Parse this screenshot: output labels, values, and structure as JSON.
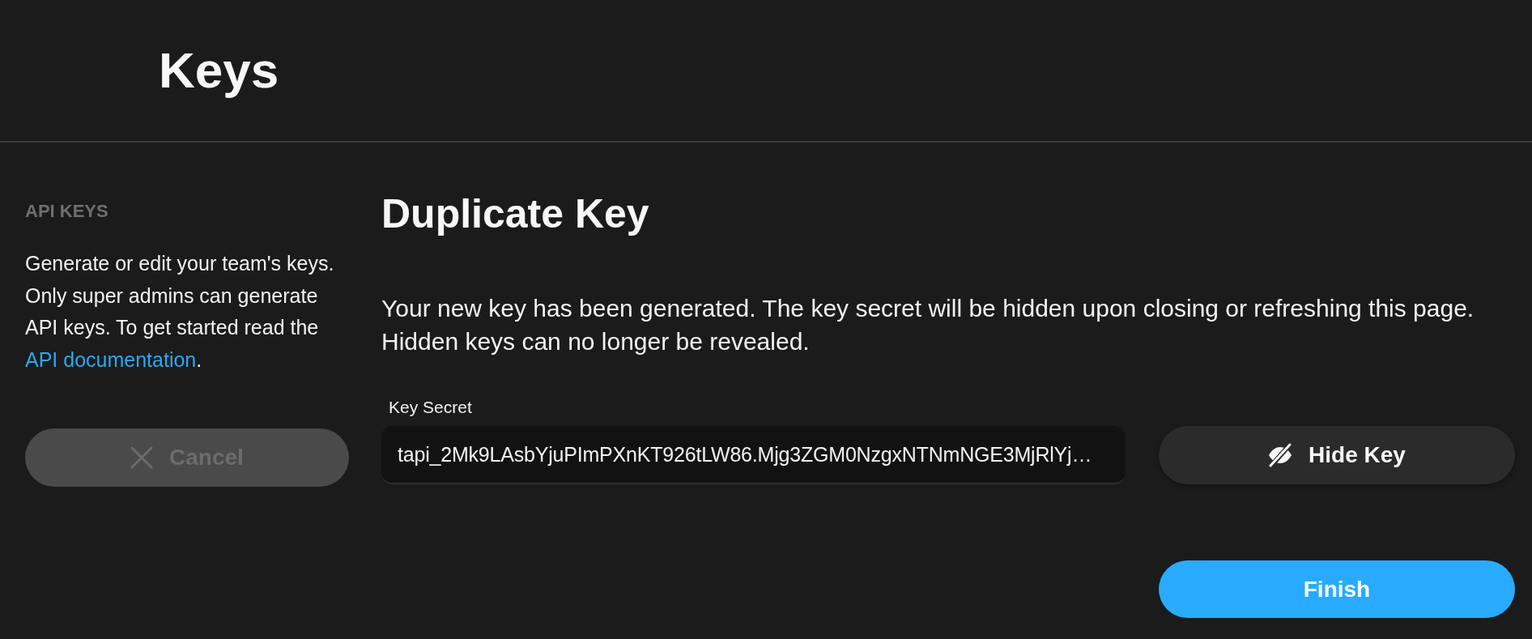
{
  "header": {
    "title": "Keys"
  },
  "sidebar": {
    "section_title": "API KEYS",
    "description": "Generate or edit your team's keys. Only super admins can generate API keys. To get started read the ",
    "link": "API documentation",
    "link_suffix": ".",
    "cancel_button": {
      "label": "Cancel",
      "disabled": true
    }
  },
  "main": {
    "title": "Duplicate Key",
    "message": "Your new key has been generated. The key secret will be hidden upon closing or refreshing this page. Hidden keys can no longer be revealed.",
    "key_field": {
      "label": "Key Secret",
      "value": "tapi_2Mk9LAsbYjuPImPXnKT926tLW86.Mjg3ZGM0NzgxNTNmNGE3MjRlYj…"
    },
    "hide_button": {
      "label": "Hide Key"
    },
    "finish_button": {
      "label": "Finish"
    }
  }
}
